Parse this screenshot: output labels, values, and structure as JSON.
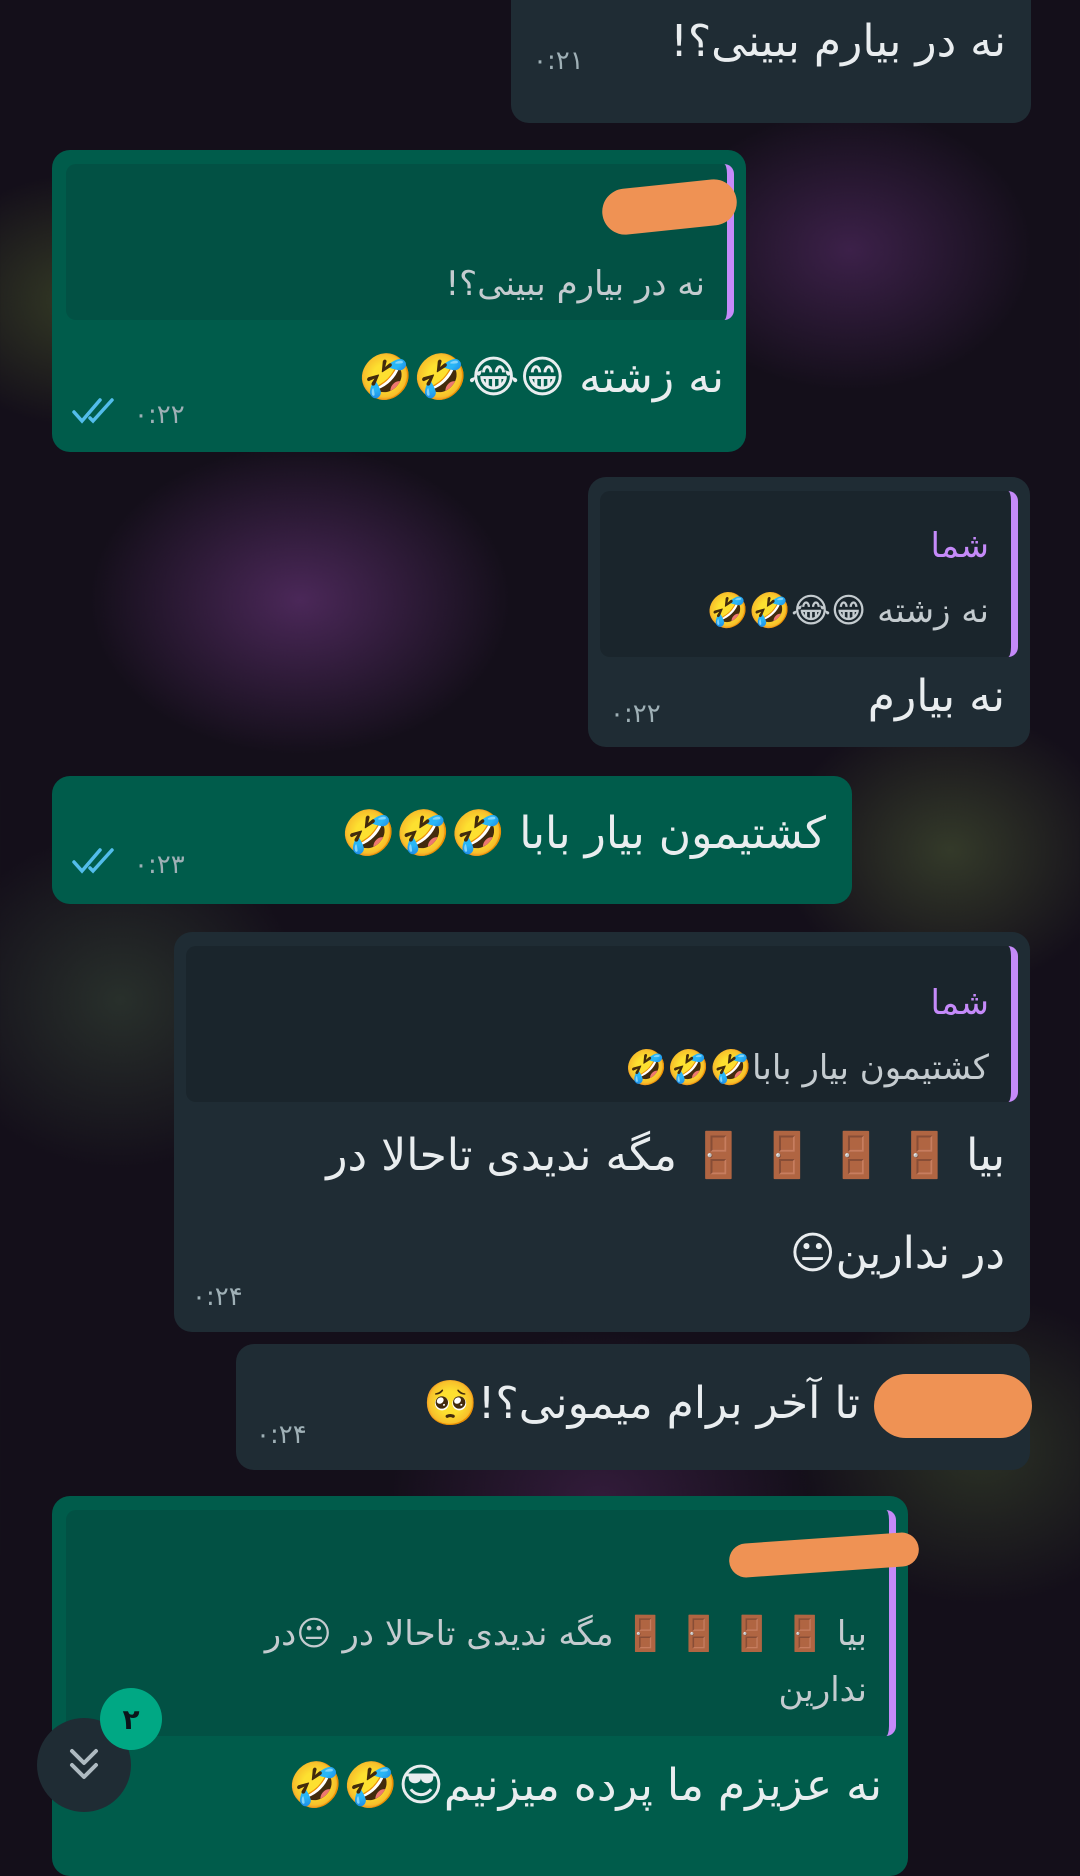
{
  "messages": [
    {
      "id": "m1",
      "dir": "in",
      "text": "نه در بیارم ببینی؟!",
      "time": "۰:۲۱"
    },
    {
      "id": "m2",
      "dir": "out",
      "quote_text": "نه در بیارم ببینی؟!",
      "text": "نه زشته 😁😂🤣🤣",
      "time": "۰:۲۲"
    },
    {
      "id": "m3",
      "dir": "in",
      "quote_name": "شما",
      "quote_text": "نه زشته 😁😂🤣🤣",
      "text": "نه بیارم",
      "time": "۰:۲۲"
    },
    {
      "id": "m4",
      "dir": "out",
      "text": "کشتیمون بیار بابا 🤣🤣🤣",
      "time": "۰:۲۳"
    },
    {
      "id": "m5",
      "dir": "in",
      "quote_name": "شما",
      "quote_text": "کشتیمون بیار بابا🤣🤣🤣",
      "text_line1": "بیا 🚪 🚪 🚪 🚪 مگه ندیدی تاحالا در",
      "text_line2": "در ندارین😐",
      "time": "۰:۲۴"
    },
    {
      "id": "m6",
      "dir": "in",
      "text": "تا آخر برام میمونی؟!🥺",
      "time": "۰:۲۴"
    },
    {
      "id": "m7",
      "dir": "out",
      "quote_text_line1": "بیا 🚪 🚪 🚪 🚪 مگه ندیدی تاحالا در 😐در",
      "quote_text_line2": "ندارین",
      "text": "نه عزیزم ما پرده میزنیم😎🤣🤣"
    }
  ],
  "scroll_badge": "۲",
  "colors": {
    "incoming": "#1f2c34",
    "outgoing": "#005c4b",
    "quote_bar": "#c58af9",
    "read_ticks": "#53bdeb",
    "badge": "#00a884"
  },
  "icons": {
    "read": "double-check-icon",
    "scroll": "double-chevron-down-icon"
  }
}
